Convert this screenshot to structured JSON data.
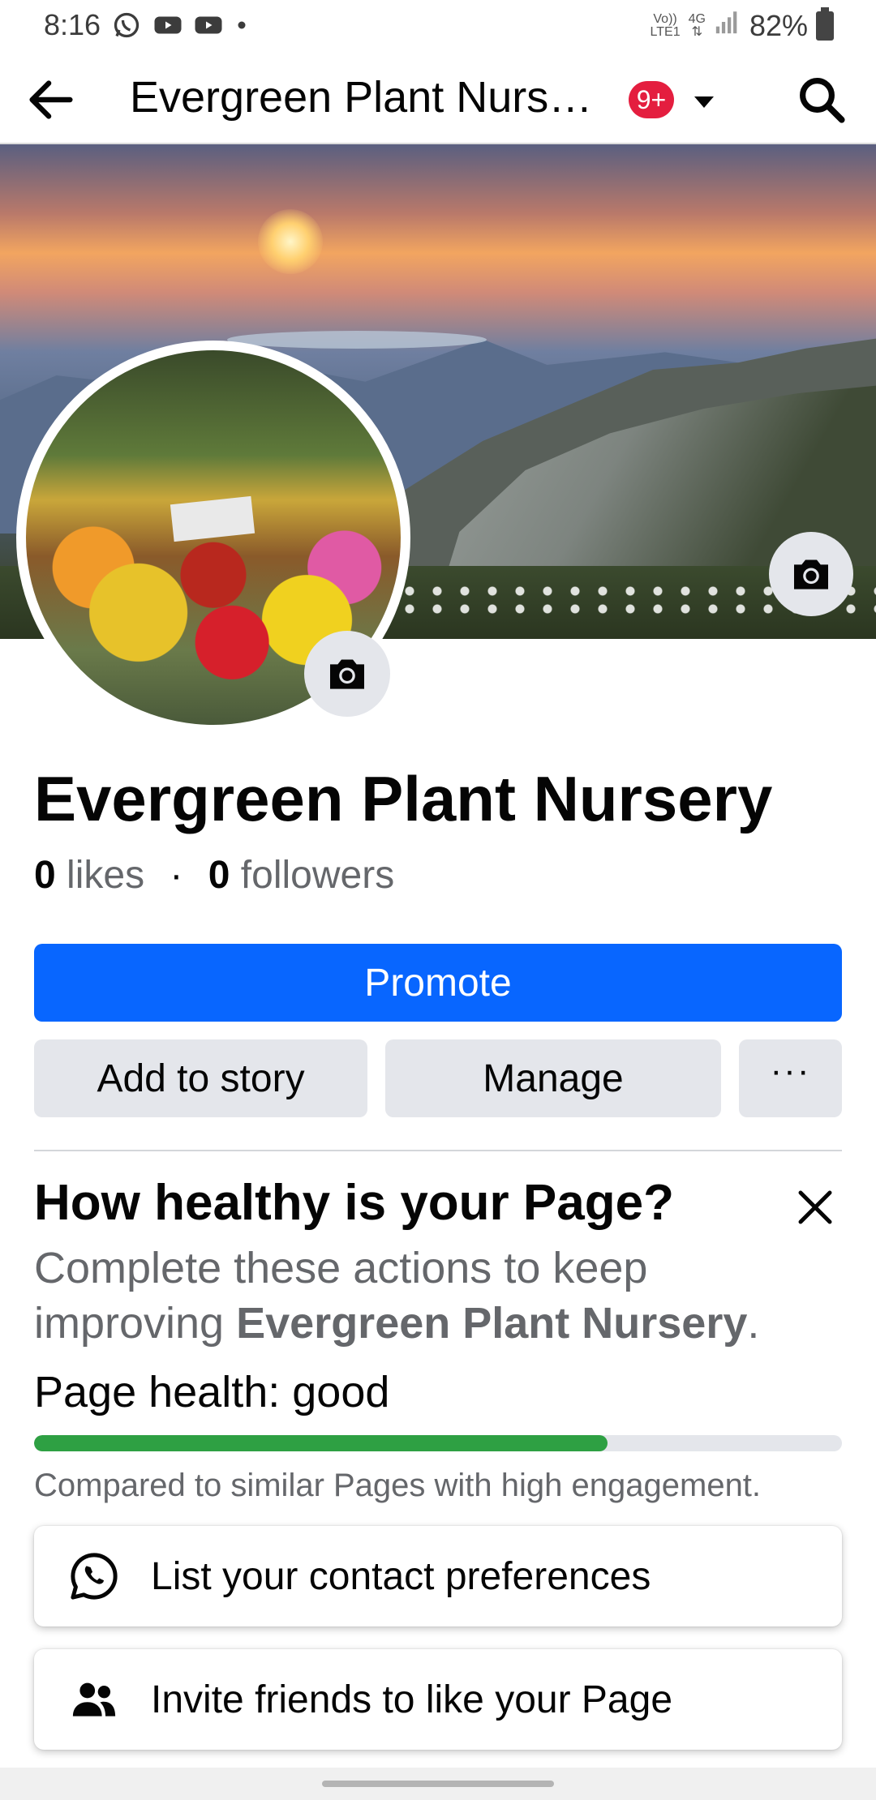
{
  "status_bar": {
    "time": "8:16",
    "notification_icons": [
      "whatsapp-icon",
      "youtube-icon",
      "youtube-icon",
      "dot-icon"
    ],
    "network_label_top": "Vo))",
    "network_label_bottom": "LTE1",
    "network_type": "4G",
    "battery_percent": "82%"
  },
  "app_bar": {
    "title": "Evergreen Plant Nursery",
    "notification_badge": "9+"
  },
  "page": {
    "name": "Evergreen Plant Nursery",
    "likes_count": "0",
    "likes_label": "likes",
    "followers_count": "0",
    "followers_label": "followers",
    "separator": "·"
  },
  "actions": {
    "promote_label": "Promote",
    "add_to_story_label": "Add to story",
    "manage_label": "Manage",
    "more_label": "···"
  },
  "health_card": {
    "title": "How healthy is your Page?",
    "description_prefix": "Complete these actions to keep improving ",
    "description_page_name": "Evergreen Plant Nursery",
    "description_suffix": ".",
    "status_text": "Page health: good",
    "progress_fraction": 0.71,
    "progress_color": "#2ea043",
    "comparison_text": "Compared to similar Pages with high engagement."
  },
  "action_cards": [
    {
      "icon": "whatsapp-icon",
      "label": "List your contact preferences"
    },
    {
      "icon": "people-icon",
      "label": "Invite friends to like your Page"
    }
  ],
  "colors": {
    "primary": "#0866ff",
    "secondary_button": "#e4e6eb",
    "badge": "#e41e3f"
  }
}
